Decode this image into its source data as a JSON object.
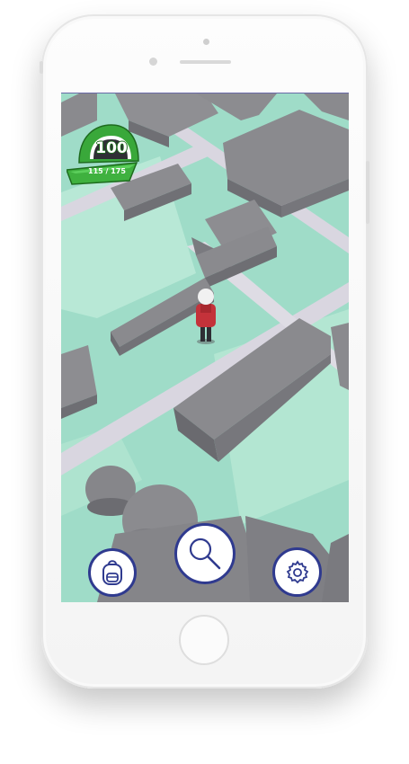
{
  "player": {
    "level": "100",
    "xp_text": "115 / 175"
  },
  "controls": {
    "backpack_icon": "backpack-icon",
    "search_icon": "magnifier-icon",
    "settings_icon": "gear-icon"
  },
  "colors": {
    "accent": "#2f3a8f",
    "level_green": "#3cae3c",
    "ground": "#9fdcc8",
    "road": "#d9d6e0",
    "building": "#8a8a8e"
  }
}
